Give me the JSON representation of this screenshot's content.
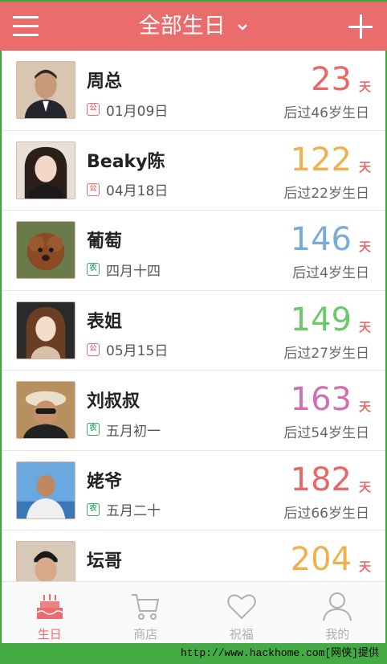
{
  "header": {
    "title": "全部生日"
  },
  "colors": {
    "brand": "#ea6c6c",
    "red_days": "#e86868",
    "orange_days": "#f0b050",
    "blue_days": "#7aaad8",
    "green_days": "#6cc86c",
    "pink_days": "#d070b0"
  },
  "birthdays": [
    {
      "name": "周总",
      "calendar": "公",
      "date": "01月09日",
      "days": "23",
      "days_unit": "天",
      "note": "后过46岁生日",
      "color": "#e86868"
    },
    {
      "name": "Beaky陈",
      "calendar": "公",
      "date": "04月18日",
      "days": "122",
      "days_unit": "天",
      "note": "后过22岁生日",
      "color": "#f0b050"
    },
    {
      "name": "葡萄",
      "calendar": "农",
      "date": "四月十四",
      "days": "146",
      "days_unit": "天",
      "note": "后过4岁生日",
      "color": "#7aaad8"
    },
    {
      "name": "表姐",
      "calendar": "公",
      "date": "05月15日",
      "days": "149",
      "days_unit": "天",
      "note": "后过27岁生日",
      "color": "#6cc86c"
    },
    {
      "name": "刘叔叔",
      "calendar": "农",
      "date": "五月初一",
      "days": "163",
      "days_unit": "天",
      "note": "后过54岁生日",
      "color": "#d070b0"
    },
    {
      "name": "姥爷",
      "calendar": "农",
      "date": "五月二十",
      "days": "182",
      "days_unit": "天",
      "note": "后过66岁生日",
      "color": "#e86868"
    },
    {
      "name": "坛哥",
      "calendar": "",
      "date": "",
      "days": "204",
      "days_unit": "天",
      "note": "",
      "color": "#f0b050"
    }
  ],
  "tabs": [
    {
      "label": "生日",
      "icon": "cake-icon",
      "active": true
    },
    {
      "label": "商店",
      "icon": "cart-icon",
      "active": false
    },
    {
      "label": "祝福",
      "icon": "heart-icon",
      "active": false
    },
    {
      "label": "我的",
      "icon": "person-icon",
      "active": false
    }
  ],
  "footer": {
    "text": "http://www.hackhome.com[网侠]提供"
  }
}
